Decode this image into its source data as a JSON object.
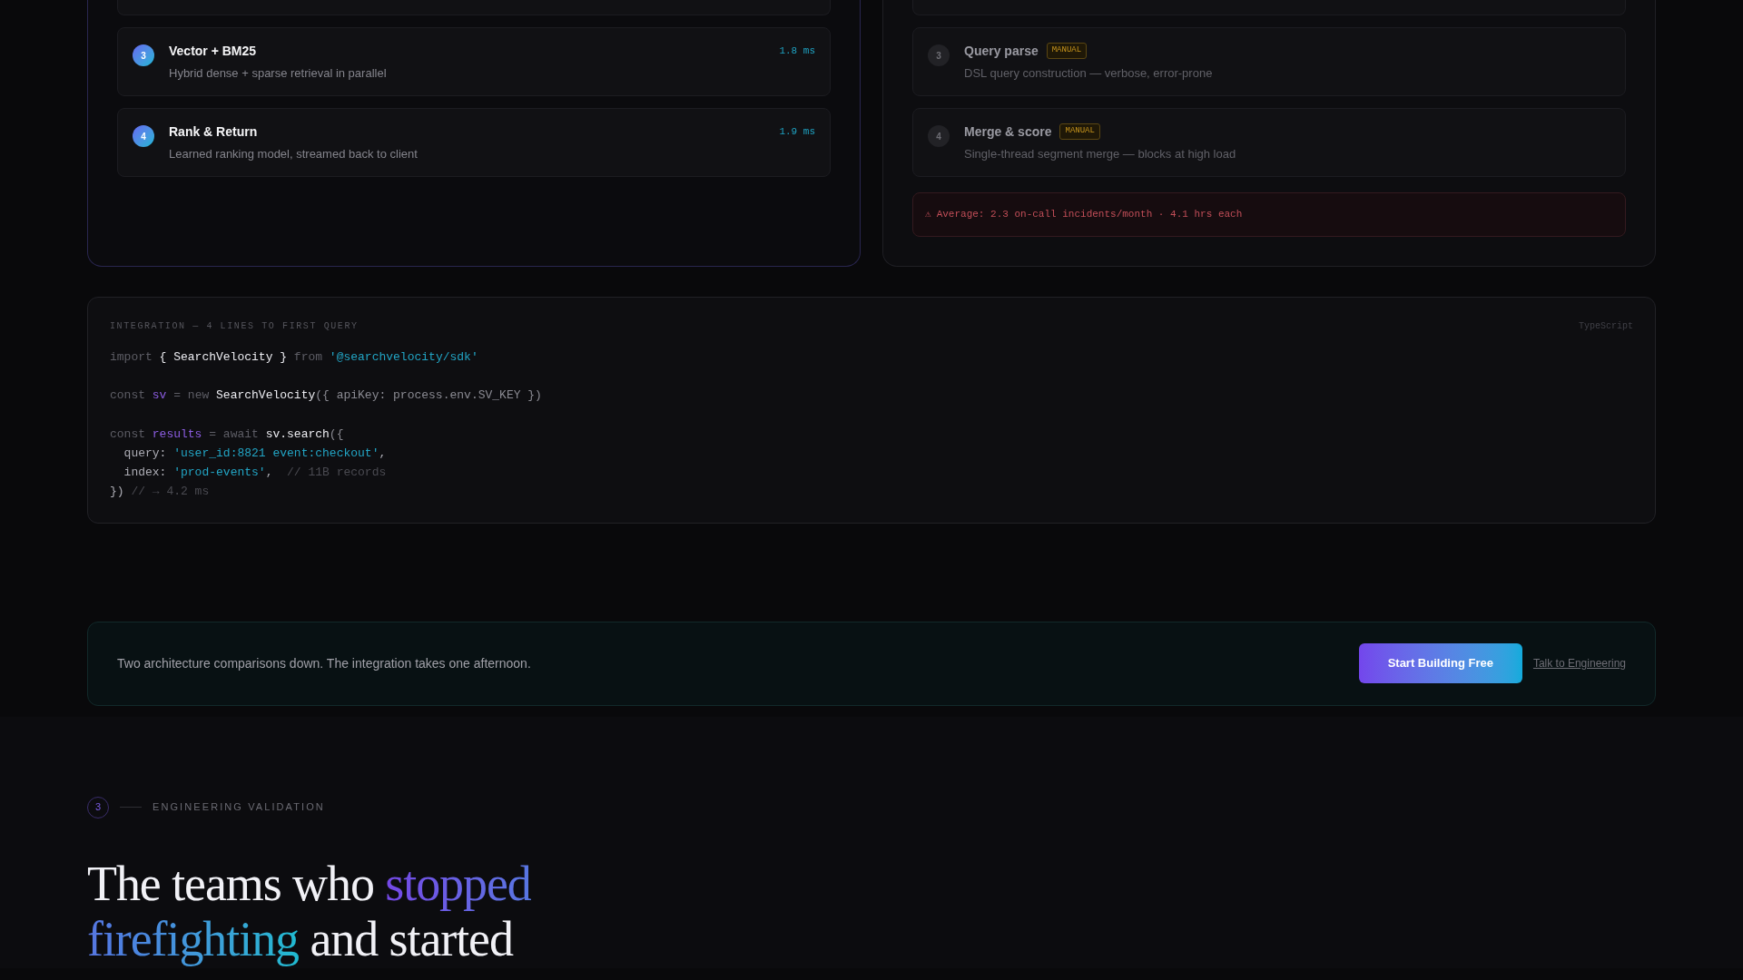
{
  "panels": [
    {
      "highlighted": true,
      "clipped_step_above": true,
      "steps": [
        {
          "number": "3",
          "title": "Vector + BM25",
          "description": "Hybrid dense + sparse retrieval in parallel",
          "timing": "1.8 ms"
        },
        {
          "number": "4",
          "title": "Rank & Return",
          "description": "Learned ranking model, streamed back to client",
          "timing": "1.9 ms"
        }
      ]
    },
    {
      "highlighted": false,
      "clipped_step_above": true,
      "steps": [
        {
          "number": "3",
          "title": "Query parse",
          "badge": "MANUAL",
          "description": "DSL query construction — verbose, error-prone"
        },
        {
          "number": "4",
          "title": "Merge & score",
          "badge": "MANUAL",
          "description": "Single-thread segment merge — blocks at high load"
        }
      ],
      "alert": {
        "icon": "⚠",
        "text": "Average: 2.3 on-call incidents/month · 4.1 hrs each"
      }
    }
  ],
  "code_sample": {
    "label": "INTEGRATION — 4 LINES TO FIRST QUERY",
    "language": "TypeScript",
    "lines": [
      {
        "kind": "code",
        "tokens": [
          {
            "text": "import ",
            "kind": "keyword"
          },
          {
            "text": "{ SearchVelocity } ",
            "kind": "name"
          },
          {
            "text": "from ",
            "kind": "keyword"
          },
          {
            "text": "'@searchvelocity/sdk'",
            "kind": "string"
          }
        ]
      },
      {
        "kind": "blank"
      },
      {
        "kind": "code",
        "tokens": [
          {
            "text": "const ",
            "kind": "keyword"
          },
          {
            "text": "sv",
            "kind": "variable"
          },
          {
            "text": " = new ",
            "kind": "keyword"
          },
          {
            "text": "SearchVelocity",
            "kind": "name"
          },
          {
            "text": "({ apiKey: process.env.SV_KEY })",
            "kind": "punctuation"
          }
        ]
      },
      {
        "kind": "blank"
      },
      {
        "kind": "code",
        "tokens": [
          {
            "text": "const ",
            "kind": "keyword"
          },
          {
            "text": "results",
            "kind": "variable"
          },
          {
            "text": " = await ",
            "kind": "keyword"
          },
          {
            "text": "sv.search",
            "kind": "name"
          },
          {
            "text": "({",
            "kind": "punctuation"
          }
        ]
      },
      {
        "kind": "code",
        "tokens": [
          {
            "text": "  query: ",
            "kind": "property"
          },
          {
            "text": "'user_id:8821 event:checkout'",
            "kind": "string"
          },
          {
            "text": ",",
            "kind": "property"
          }
        ]
      },
      {
        "kind": "code",
        "tokens": [
          {
            "text": "  index: ",
            "kind": "property"
          },
          {
            "text": "'prod-events'",
            "kind": "string"
          },
          {
            "text": ",  ",
            "kind": "property"
          },
          {
            "text": "// 11B records",
            "kind": "comment"
          }
        ]
      },
      {
        "kind": "code",
        "tokens": [
          {
            "text": "})",
            "kind": "property"
          },
          {
            "text": " // → 4.2 ms",
            "kind": "comment"
          }
        ]
      }
    ]
  },
  "cta_banner": {
    "text": "Two architecture comparisons down. The integration takes one afternoon.",
    "primary_button": "Start Building Free",
    "link": "Talk to Engineering"
  },
  "section": {
    "number": "3",
    "eyebrow": "ENGINEERING VALIDATION",
    "heading": [
      {
        "text": "The teams who ",
        "accent": false
      },
      {
        "text": "stopped firefighting",
        "accent": true
      },
      {
        "text": " and started",
        "accent": false
      }
    ]
  }
}
